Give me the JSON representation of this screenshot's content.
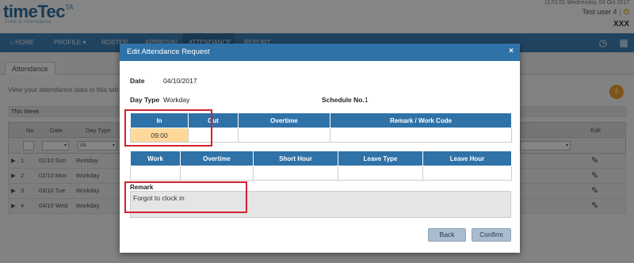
{
  "app": {
    "logo_text": "timeTec",
    "logo_suffix": "TA",
    "logo_subtitle": "Time & Attendance",
    "datetime": "11:51:01 Wednesday, 04 Oct 2017",
    "user": "Test user 4",
    "separator": "|",
    "power_icon": "power-icon",
    "company": "XXX"
  },
  "nav": {
    "items": [
      "HOME",
      "PROFILE ▾",
      "ROSTER",
      "APPROVAL",
      "ATTENDANCE",
      "REPORT"
    ],
    "active_index": 4,
    "right_icons": [
      "clock-icon",
      "grid-icon"
    ]
  },
  "page": {
    "tab": "Attendance",
    "description": "View your attendance data in this tab",
    "week_label": "This Week",
    "help_icon": "download-icon",
    "grid_headers": [
      "No",
      "Date",
      "Day Type",
      "Edit"
    ],
    "day_type_filter": "All",
    "rows": [
      {
        "no": "1",
        "date": "01/10 Sun",
        "day_type": "Restday"
      },
      {
        "no": "2",
        "date": "02/10 Mon",
        "day_type": "Workday"
      },
      {
        "no": "3",
        "date": "03/10 Tue",
        "day_type": "Workday"
      },
      {
        "no": "4",
        "date": "04/10 Wed",
        "day_type": "Workday"
      }
    ]
  },
  "modal": {
    "title": "Edit Attendance Request",
    "close": "×",
    "date_label": "Date",
    "date_value": "04/10/2017",
    "day_type_label": "Day Type",
    "day_type_value": "Workday",
    "schedule_label": "Schedule No.",
    "schedule_value": "1",
    "table1": {
      "headers": [
        "In",
        "Out",
        "Overtime",
        "Remark / Work Code"
      ],
      "values": [
        "09:00",
        "",
        "",
        ""
      ]
    },
    "table2": {
      "headers": [
        "Work",
        "Overtime",
        "Short Hour",
        "Leave Type",
        "Leave Hour"
      ],
      "values": [
        "",
        "",
        "",
        "",
        ""
      ]
    },
    "remark_label": "Remark",
    "remark_value": "Forgot to clock in",
    "back_button": "Back",
    "confirm_button": "Confirm"
  },
  "highlight_color": "#d4212f",
  "accent_color": "#2f72a8"
}
